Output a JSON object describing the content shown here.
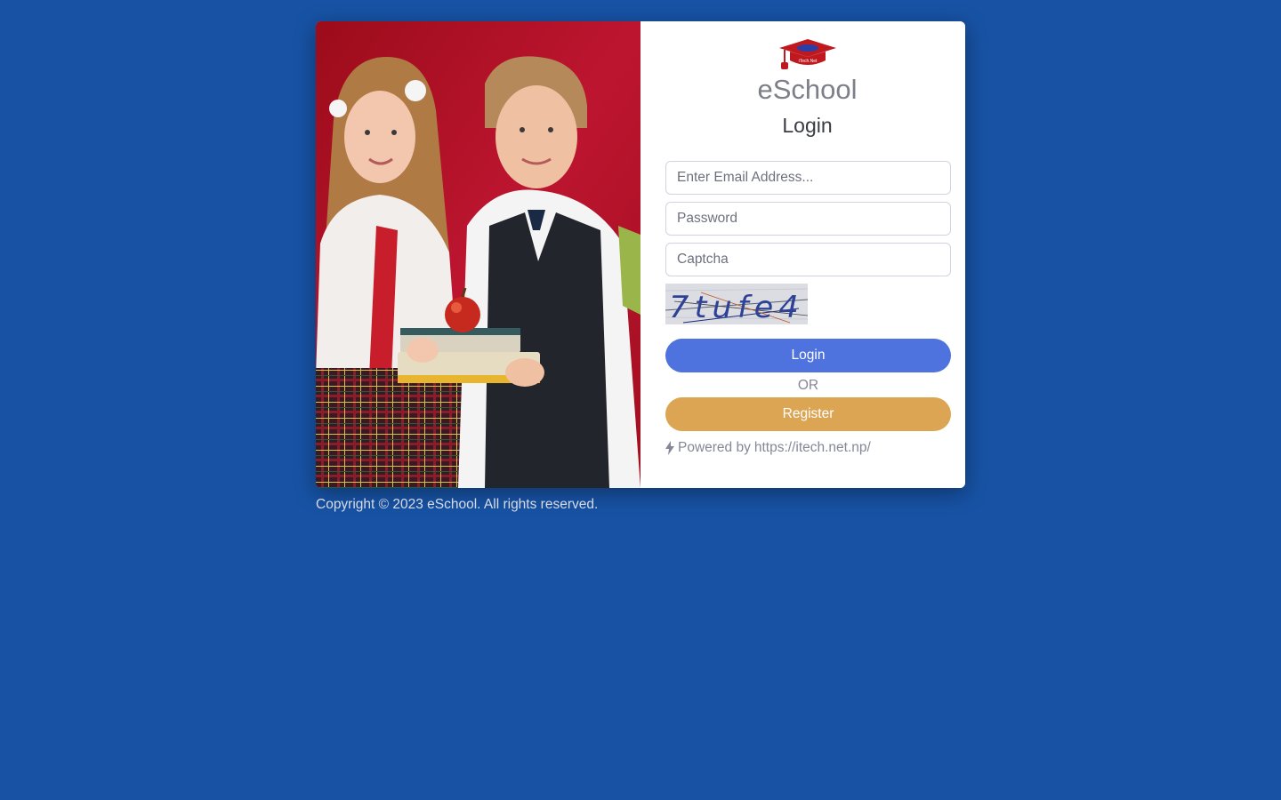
{
  "brand": {
    "name": "eSchool",
    "logo_icon": "graduation-cap-logo",
    "logo_badge_text": "iTech.Net"
  },
  "form": {
    "title": "Login",
    "email_placeholder": "Enter Email Address...",
    "password_placeholder": "Password",
    "captcha_placeholder": "Captcha",
    "captcha_text": "7tufe4",
    "login_label": "Login",
    "or_label": "OR",
    "register_label": "Register"
  },
  "powered": {
    "icon": "bolt-icon",
    "prefix": "Powered by",
    "link_text": "https://itech.net.np/"
  },
  "footer": {
    "copyright": "Copyright © 2023 eSchool. All rights reserved."
  },
  "colors": {
    "page_background": "#1752a4",
    "login_button": "#4e73df",
    "register_button": "#dba554",
    "photo_background": "#b81428"
  }
}
